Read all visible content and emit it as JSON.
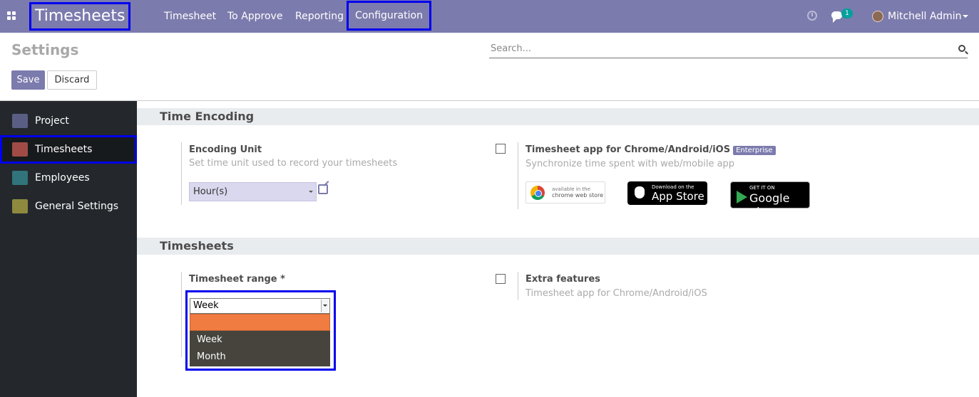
{
  "navbar": {
    "brand": "Timesheets",
    "menu": [
      "Timesheet",
      "To Approve",
      "Reporting",
      "Configuration"
    ],
    "chat_count": "1",
    "user_name": "Mitchell Admin",
    "bg_color": "#7c7bad"
  },
  "control_panel": {
    "title": "Settings",
    "search_placeholder": "Search...",
    "save_label": "Save",
    "discard_label": "Discard"
  },
  "sidebar": {
    "items": [
      {
        "label": "Project",
        "icon": "project-icon",
        "color": "#5b5e84"
      },
      {
        "label": "Timesheets",
        "icon": "stopwatch-icon",
        "color": "#a04b45",
        "active": true
      },
      {
        "label": "Employees",
        "icon": "employees-icon",
        "color": "#31747b"
      },
      {
        "label": "General Settings",
        "icon": "gear-icon",
        "color": "#8d8a3f"
      }
    ]
  },
  "time_encoding": {
    "header": "Time Encoding",
    "encoding_unit": {
      "label": "Encoding Unit",
      "description": "Set time unit used to record your timesheets",
      "value": "Hour(s)"
    },
    "mobile_app": {
      "label": "Timesheet app for Chrome/Android/iOS",
      "badge": "Enterprise",
      "description": "Synchronize time spent with web/mobile app",
      "checked": false,
      "store_badges": {
        "chrome_line1": "available in the",
        "chrome_line2": "chrome web store",
        "apple_line1": "Download on the",
        "apple_line2": "App Store",
        "google_line1": "GET IT ON",
        "google_line2": "Google play"
      }
    }
  },
  "timesheets": {
    "header": "Timesheets",
    "range": {
      "label": "Timesheet range *",
      "value": "Week",
      "options": [
        "",
        "Week",
        "Month"
      ]
    },
    "extra": {
      "label": "Extra features",
      "description": "Timesheet app for Chrome/Android/iOS",
      "checked": false
    }
  }
}
